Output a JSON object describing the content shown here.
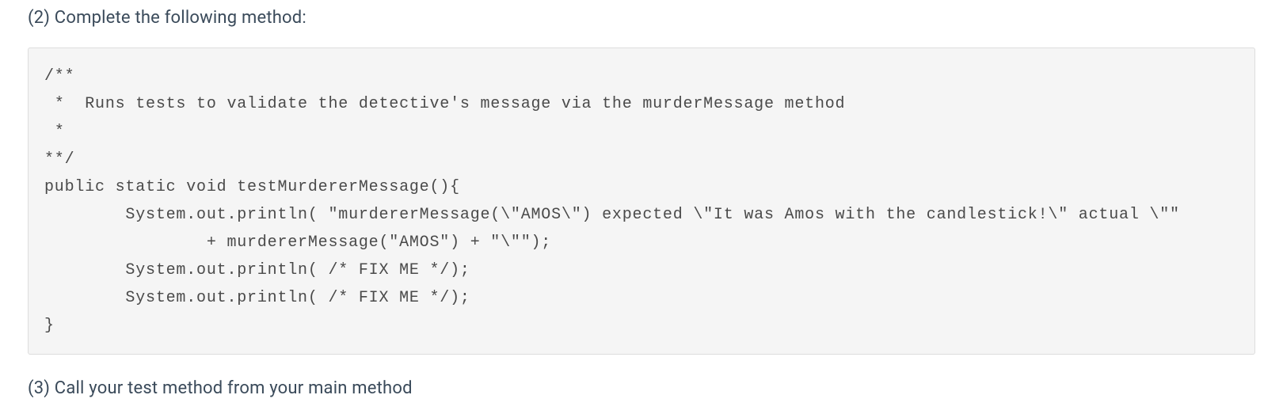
{
  "instructions": {
    "top": "(2) Complete the following method:",
    "bottom": "(3) Call your test method from your main method"
  },
  "code": "/**\n *  Runs tests to validate the detective's message via the murderMessage method\n *\n**/\npublic static void testMurdererMessage(){\n        System.out.println( \"murdererMessage(\\\"AMOS\\\") expected \\\"It was Amos with the candlestick!\\\" actual \\\"\"\n                + murdererMessage(\"AMOS\") + \"\\\"\");\n        System.out.println( /* FIX ME */);\n        System.out.println( /* FIX ME */);\n}"
}
